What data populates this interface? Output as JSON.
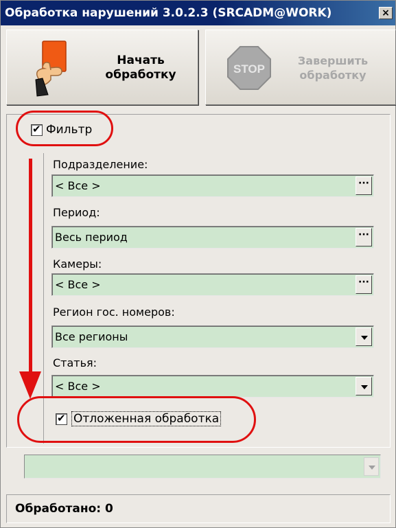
{
  "window": {
    "title": "Обработка нарушений 3.0.2.3 (SRCADM@WORK)",
    "close_glyph": "×"
  },
  "toolbar": {
    "start_label": "Начать обработку",
    "stop_sign_text": "STOP",
    "stop_label": "Завершить обработку"
  },
  "filter": {
    "label": "Фильтр",
    "checked": true
  },
  "fields": {
    "division": {
      "label": "Подразделение:",
      "value": "< Все >"
    },
    "period": {
      "label": "Период:",
      "value": "Весь период"
    },
    "cameras": {
      "label": "Камеры:",
      "value": "< Все >"
    },
    "region": {
      "label": "Регион гос. номеров:",
      "value": "Все регионы"
    },
    "article": {
      "label": "Статья:",
      "value": "< Все >"
    }
  },
  "deferred": {
    "label": "Отложенная обработка",
    "checked": true
  },
  "bottom_combo": {
    "value": ""
  },
  "status": {
    "text": "Обработано: 0"
  },
  "colors": {
    "field_bg": "#cfe7cf",
    "annotation_red": "#e01010",
    "title_bg": "#0a246a"
  }
}
